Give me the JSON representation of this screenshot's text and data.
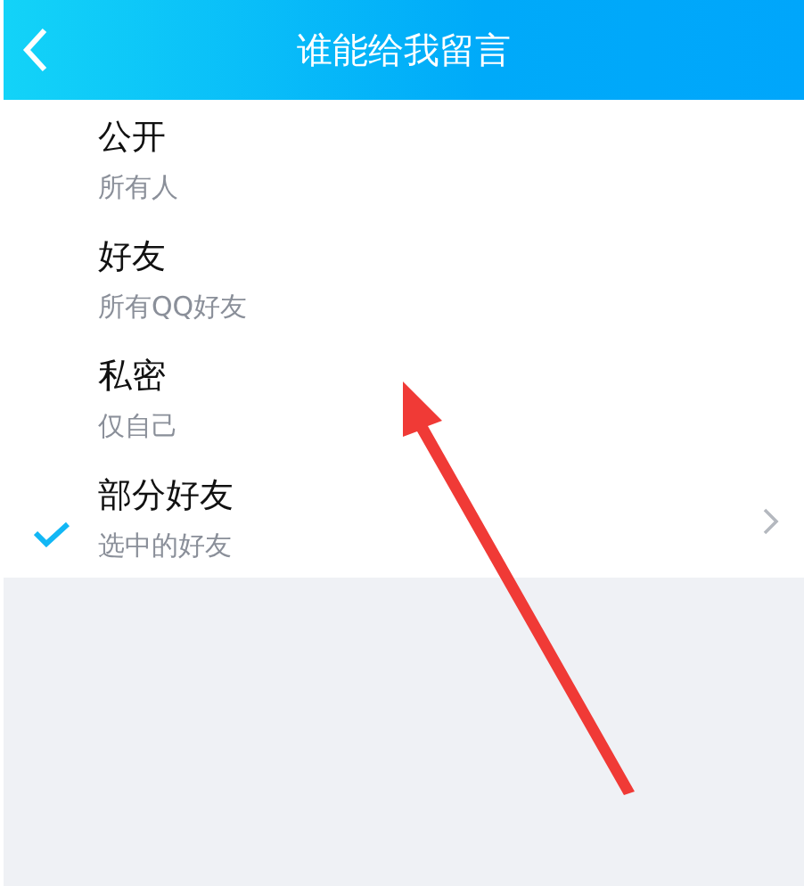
{
  "header": {
    "title": "谁能给我留言"
  },
  "options": [
    {
      "title": "公开",
      "subtitle": "所有人",
      "selected": false,
      "chevron": false
    },
    {
      "title": "好友",
      "subtitle": "所有QQ好友",
      "selected": false,
      "chevron": false
    },
    {
      "title": "私密",
      "subtitle": "仅自己",
      "selected": false,
      "chevron": false
    },
    {
      "title": "部分好友",
      "subtitle": "选中的好友",
      "selected": true,
      "chevron": true
    }
  ]
}
